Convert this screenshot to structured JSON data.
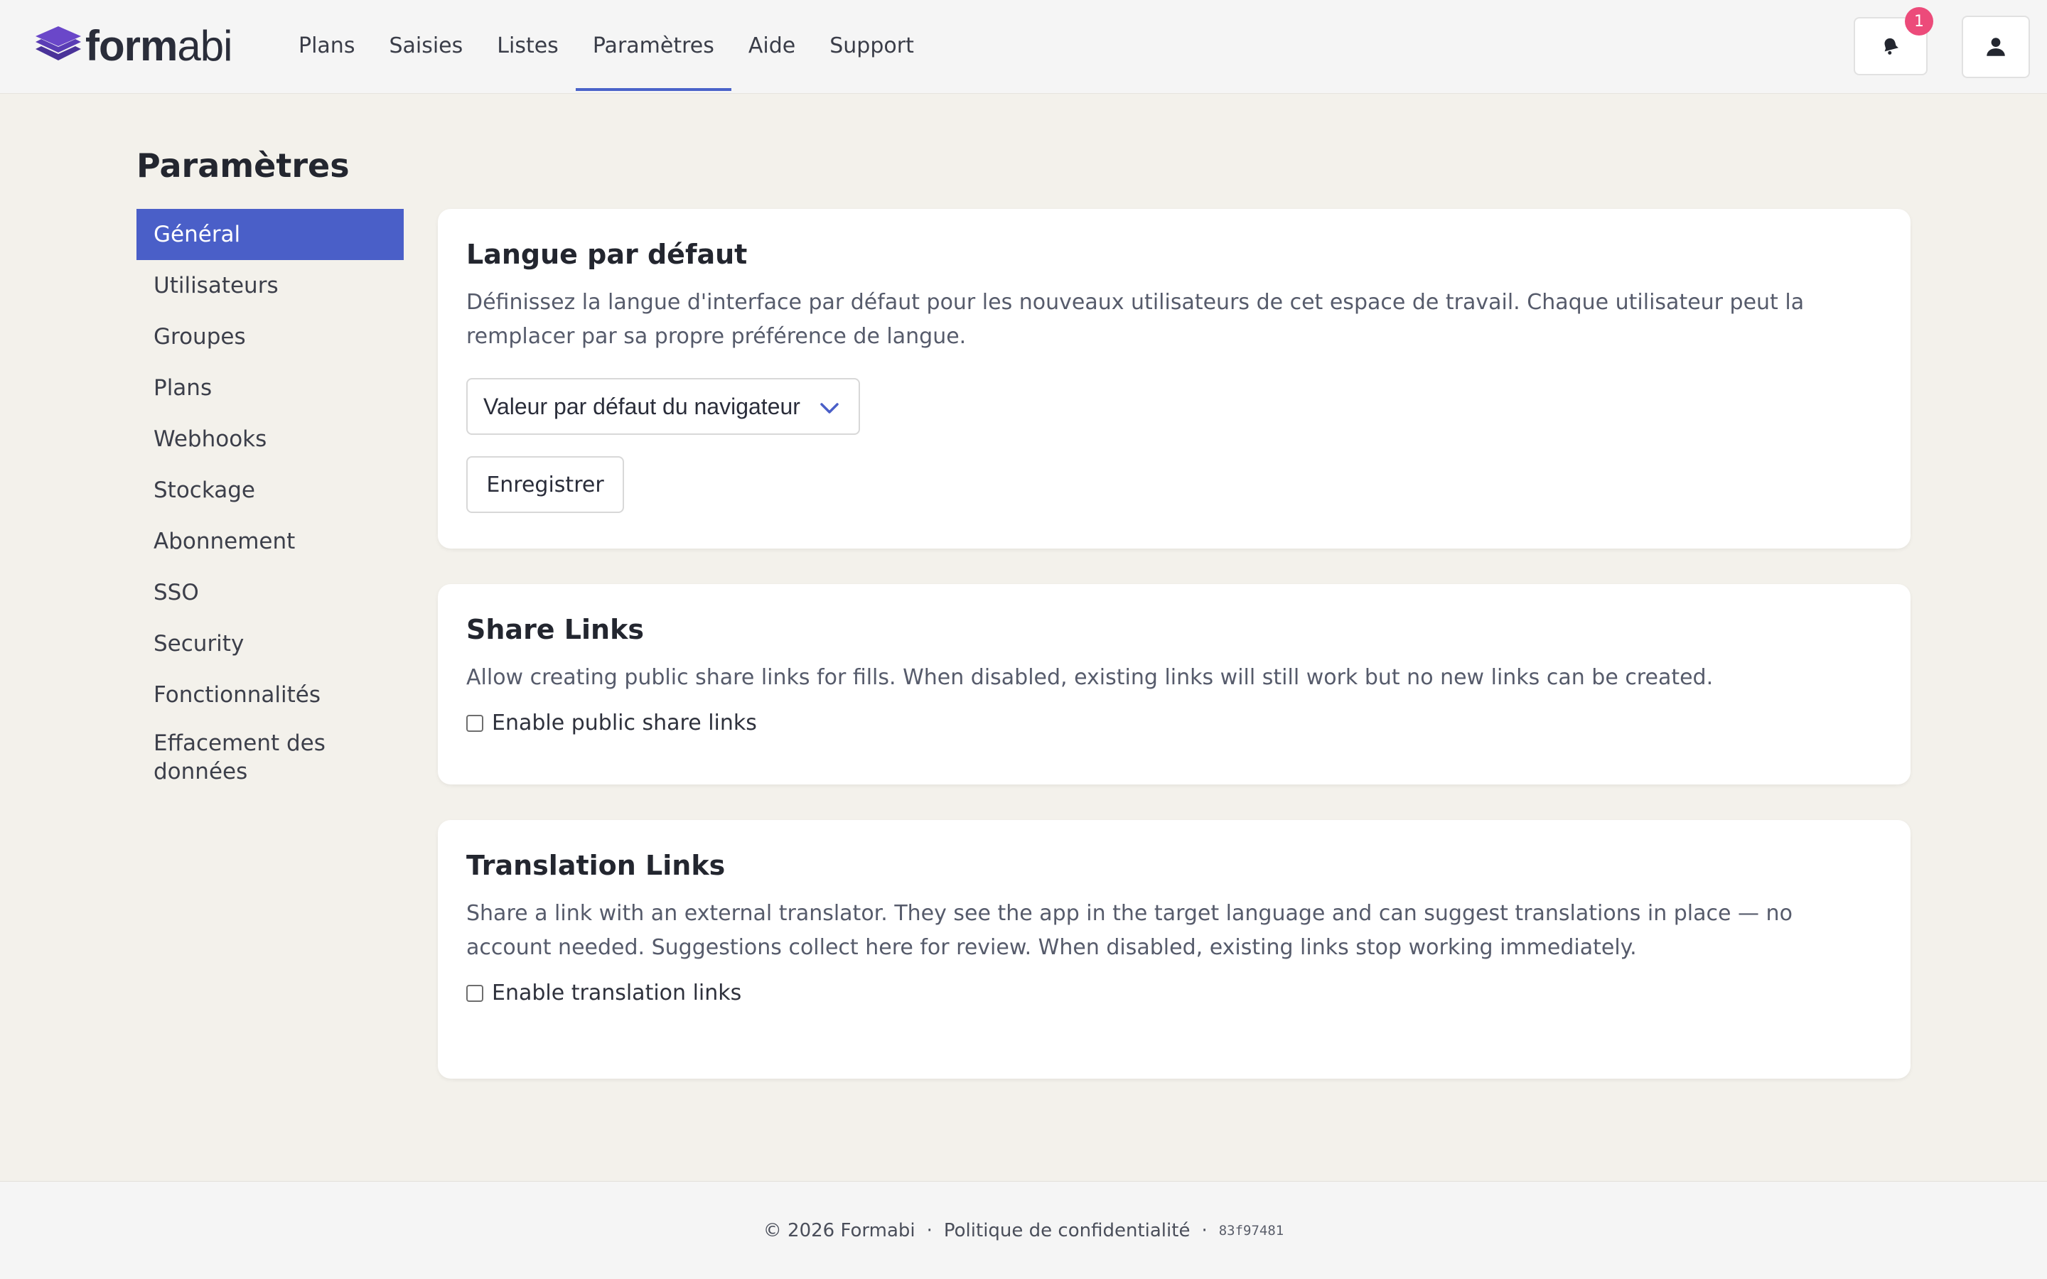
{
  "brand": {
    "name_bold": "form",
    "name_light": "abi",
    "accent": "#6a47c9"
  },
  "nav": {
    "items": [
      {
        "label": "Plans"
      },
      {
        "label": "Saisies"
      },
      {
        "label": "Listes"
      },
      {
        "label": "Paramètres",
        "active": true
      },
      {
        "label": "Aide"
      },
      {
        "label": "Support"
      }
    ],
    "notification_count": "1"
  },
  "page": {
    "title": "Paramètres"
  },
  "sidebar": {
    "items": [
      {
        "label": "Général",
        "active": true
      },
      {
        "label": "Utilisateurs"
      },
      {
        "label": "Groupes"
      },
      {
        "label": "Plans"
      },
      {
        "label": "Webhooks"
      },
      {
        "label": "Stockage"
      },
      {
        "label": "Abonnement"
      },
      {
        "label": "SSO"
      },
      {
        "label": "Security"
      },
      {
        "label": "Fonctionnalités"
      },
      {
        "label_line1": "Effacement des",
        "label_line2": "données"
      }
    ]
  },
  "cards": {
    "language": {
      "title": "Langue par défaut",
      "description": "Définissez la langue d'interface par défaut pour les nouveaux utilisateurs de cet espace de travail. Chaque utilisateur peut la remplacer par sa propre préférence de langue.",
      "select_value": "Valeur par défaut du navigateur",
      "save_label": "Enregistrer"
    },
    "share": {
      "title": "Share Links",
      "description": "Allow creating public share links for fills. When disabled, existing links will still work but no new links can be created.",
      "checkbox_label": "Enable public share links",
      "checked": false
    },
    "translation": {
      "title": "Translation Links",
      "description": "Share a link with an external translator. They see the app in the target language and can suggest translations in place — no account needed. Suggestions collect here for review. When disabled, existing links stop working immediately.",
      "checkbox_label": "Enable translation links",
      "checked": false
    }
  },
  "footer": {
    "copyright": "© 2026 Formabi",
    "separator": "·",
    "privacy": "Politique de confidentialité",
    "hash": "83f97481"
  },
  "colors": {
    "primary": "#4a5fc8",
    "badge": "#ec4b7a",
    "background": "#f3f1eb"
  }
}
